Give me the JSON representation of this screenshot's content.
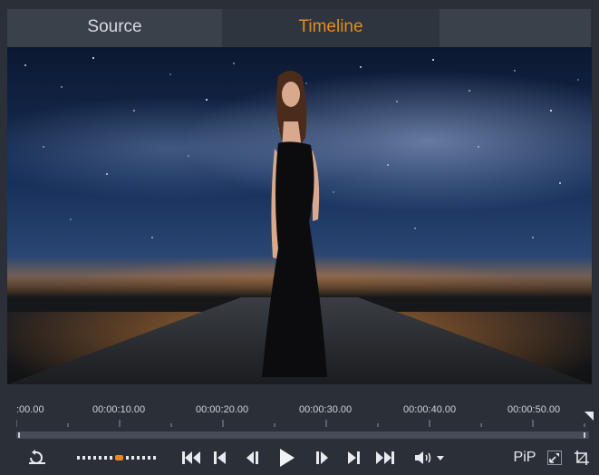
{
  "tabs": {
    "source_label": "Source",
    "timeline_label": "Timeline"
  },
  "timeline": {
    "timecodes": [
      ":00.00",
      "00:00:10.00",
      "00:00:20.00",
      "00:00:30.00",
      "00:00:40.00",
      "00:00:50.00"
    ]
  },
  "controls": {
    "pip_label": "PiP"
  },
  "icons": {
    "loop": "loop-icon",
    "jog": "jog-shuttle-icon",
    "go_start": "go-to-start-icon",
    "prev_frame": "previous-clip-icon",
    "step_back": "step-back-icon",
    "play": "play-icon",
    "step_forward": "step-forward-icon",
    "next_clip": "next-clip-icon",
    "go_end": "go-to-end-icon",
    "volume": "volume-icon",
    "fullscreen": "fullscreen-icon",
    "crop": "crop-icon"
  },
  "colors": {
    "accent": "#e68a1e",
    "panel": "#2b3038",
    "tab_inactive": "#3a414b"
  }
}
